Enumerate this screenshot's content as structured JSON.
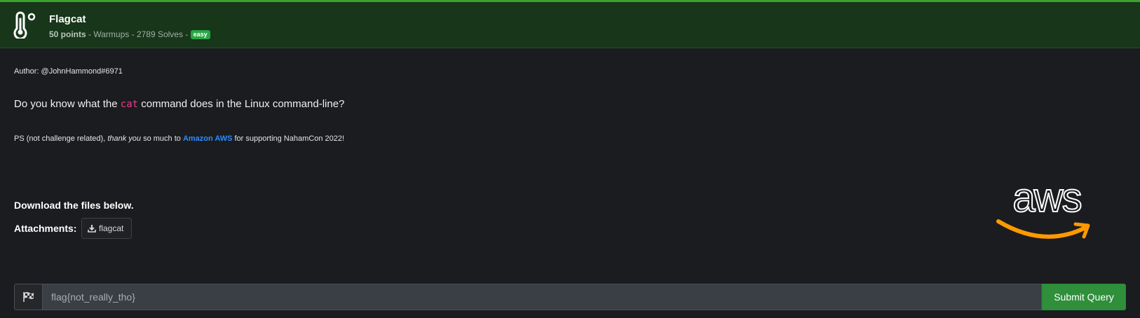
{
  "challenge": {
    "title": "Flagcat",
    "points": "50 points",
    "sep1": " - ",
    "category": "Warmups",
    "sep2": " - ",
    "solves": "2789 Solves",
    "sep3": " - ",
    "difficulty": "easy"
  },
  "description": {
    "author": "Author: @JohnHammond#6971",
    "question_before": "Do you know what the ",
    "question_code": "cat",
    "question_after": " command does in the Linux command-line?",
    "ps_before": "PS (not challenge related), ",
    "ps_italic": "thank you",
    "ps_middle": " so much to ",
    "ps_link": "Amazon AWS",
    "ps_after": " for supporting NahamCon 2022!"
  },
  "files": {
    "download_text": "Download the files below.",
    "attachments_label": "Attachments:",
    "attachment_name": "flagcat"
  },
  "submission": {
    "placeholder": "flag{not_really_tho}",
    "submit_label": "Submit Query"
  },
  "sponsor": {
    "logo_text": "aws"
  },
  "colors": {
    "accent": "#3aa12b",
    "header_bg": "#17361a",
    "badge": "#28a745",
    "link": "#2b8cff",
    "code": "#e83e8c",
    "submit": "#2f8f3b",
    "aws_arrow": "#ff9900"
  },
  "icons": [
    "thermometer-icon",
    "download-icon",
    "checkered-flag-icon",
    "aws-logo"
  ]
}
